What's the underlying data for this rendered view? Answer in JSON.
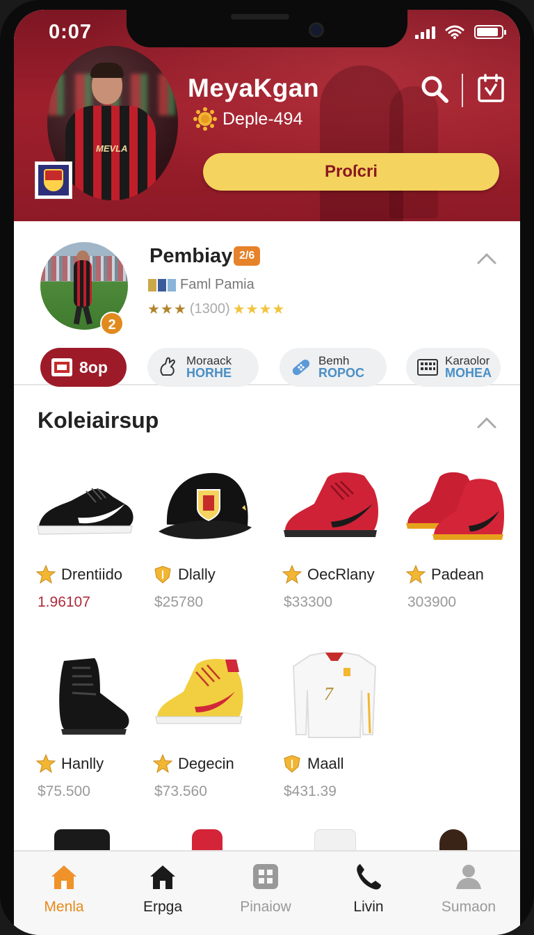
{
  "status_bar": {
    "time": "0:07"
  },
  "hero": {
    "title": "MeyaKgan",
    "subtitle": "Deple-494",
    "cta_label": "Proſcri",
    "jersey_text": "MEVLA"
  },
  "profile": {
    "name": "Pembiay",
    "tag": "2/6",
    "subtitle": "Faml Pamia",
    "rating_stars_dark": "★★★",
    "rating_count": "(1300)",
    "rating_stars_gold": "★★★★",
    "number_badge": "2",
    "chips": [
      {
        "label": "8op"
      },
      {
        "top": "Moraack",
        "bottom": "HORHE"
      },
      {
        "top": "Bemh",
        "bottom": "ROPOC"
      },
      {
        "top": "Karaolor",
        "bottom": "MOHEA"
      }
    ]
  },
  "collection": {
    "title": "Koleiairsup",
    "products": [
      {
        "name": "Drentiido",
        "price": "1.96107",
        "icon": "sneaker-black-icon"
      },
      {
        "name": "Dlally",
        "price": "$25780",
        "icon": "cap-icon"
      },
      {
        "name": "OecRlany",
        "price": "$33300",
        "icon": "sneaker-red-icon"
      },
      {
        "name": "Padean",
        "price": "303900",
        "icon": "sneakers-red-pair-icon"
      },
      {
        "name": "Hanlly",
        "price": "$75.500",
        "icon": "boot-black-icon"
      },
      {
        "name": "Degecin",
        "price": "$73.560",
        "icon": "sneaker-yellow-icon"
      },
      {
        "name": "Maall",
        "price": "$431.39",
        "icon": "jersey-icon"
      }
    ]
  },
  "tabbar": {
    "tabs": [
      {
        "label": "Menla",
        "icon": "home-icon"
      },
      {
        "label": "Erpga",
        "icon": "store-icon"
      },
      {
        "label": "Pinaiow",
        "icon": "grid-icon"
      },
      {
        "label": "Livin",
        "icon": "phone-icon"
      },
      {
        "label": "Sumaon",
        "icon": "profile-icon"
      }
    ]
  },
  "colors": {
    "brand_red": "#9d1b29",
    "accent_yellow": "#f4d35e",
    "active_tab": "#e8891a"
  }
}
